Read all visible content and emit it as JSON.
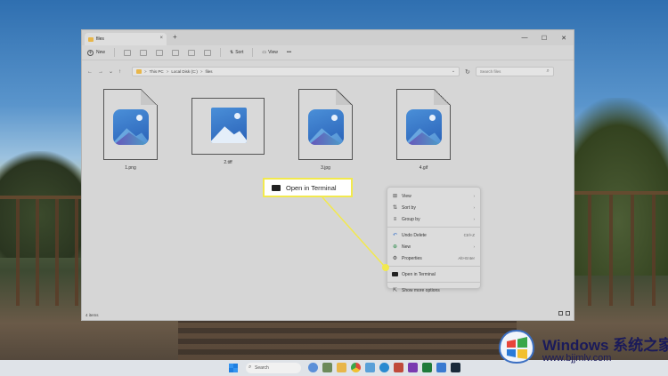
{
  "window": {
    "tab_title": "files",
    "tab_close": "×",
    "new_tab": "+",
    "minimize": "—",
    "maximize": "☐",
    "close": "✕"
  },
  "toolbar": {
    "new_label": "New",
    "sort_label": "Sort",
    "view_label": "View",
    "more": "•••"
  },
  "address": {
    "crumbs": [
      "This PC",
      "Local Disk (C:)",
      "files"
    ],
    "separator": ">",
    "search_placeholder": "Search files"
  },
  "files": [
    {
      "name": "1.png"
    },
    {
      "name": "2.tiff"
    },
    {
      "name": "3.jpg"
    },
    {
      "name": "4.gif"
    }
  ],
  "status": {
    "item_count": "4 items"
  },
  "context_menu": {
    "items": [
      {
        "label": "View",
        "icon": "grid-icon",
        "right": "›"
      },
      {
        "label": "Sort by",
        "icon": "sort-icon",
        "right": "›"
      },
      {
        "label": "Group by",
        "icon": "group-icon",
        "right": "›"
      },
      {
        "label": "Undo Delete",
        "icon": "undo-icon",
        "right": "Ctrl+Z"
      },
      {
        "label": "New",
        "icon": "new-icon",
        "right": "›"
      },
      {
        "label": "Properties",
        "icon": "wrench-icon",
        "right": "Alt+Enter"
      },
      {
        "label": "Open in Terminal",
        "icon": "terminal-icon",
        "right": ""
      },
      {
        "label": "Show more options",
        "icon": "share-icon",
        "right": ""
      }
    ]
  },
  "callout": {
    "label": "Open in Terminal",
    "color": "#f2e94e"
  },
  "taskbar": {
    "search_label": "Search"
  },
  "watermark": {
    "title": "Windows 系统之家",
    "url": "www.bjjmlv.com"
  }
}
